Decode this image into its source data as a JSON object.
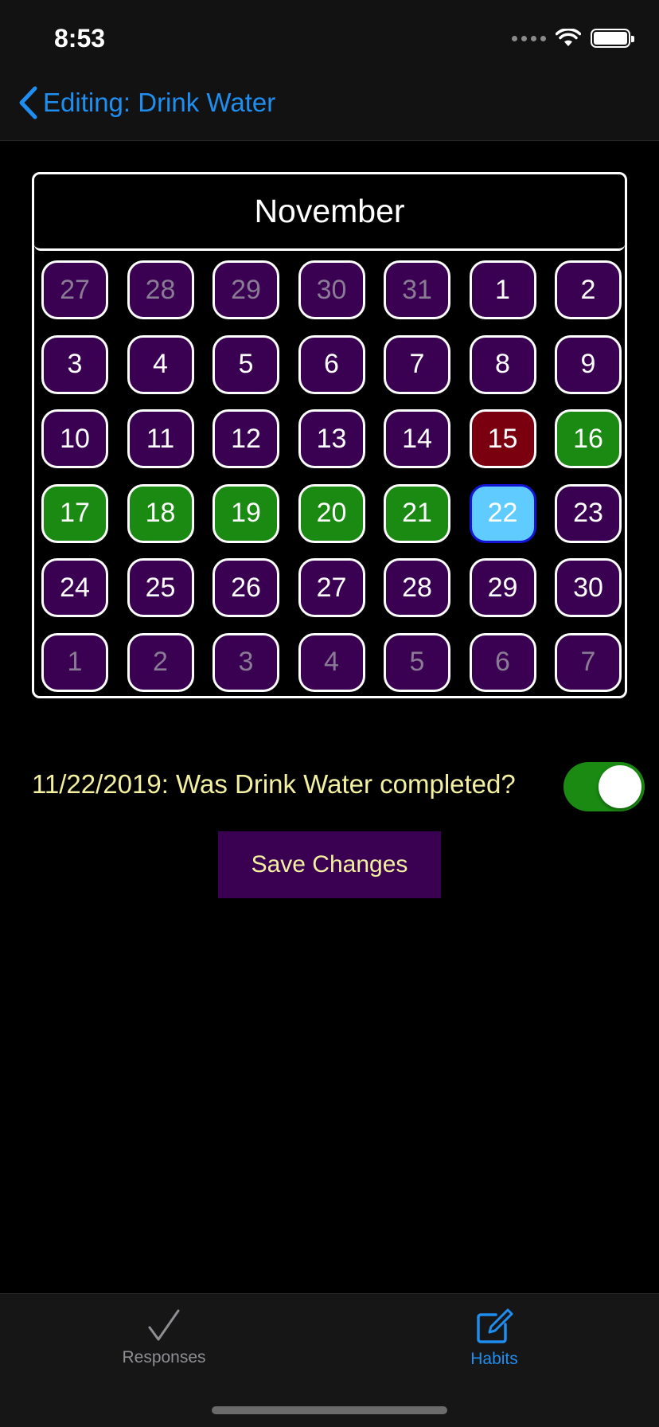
{
  "status_bar": {
    "time": "8:53"
  },
  "nav": {
    "back_icon": "chevron-left-icon",
    "title": "Editing: Drink Water"
  },
  "calendar": {
    "month": "November",
    "colors": {
      "default": "#3a0052",
      "completed": "#1a8a12",
      "missed": "#7a0010",
      "selected": "#5fcbff"
    },
    "days": [
      {
        "label": "27",
        "state": "outside"
      },
      {
        "label": "28",
        "state": "outside"
      },
      {
        "label": "29",
        "state": "outside"
      },
      {
        "label": "30",
        "state": "outside"
      },
      {
        "label": "31",
        "state": "outside"
      },
      {
        "label": "1",
        "state": "default"
      },
      {
        "label": "2",
        "state": "default"
      },
      {
        "label": "3",
        "state": "default"
      },
      {
        "label": "4",
        "state": "default"
      },
      {
        "label": "5",
        "state": "default"
      },
      {
        "label": "6",
        "state": "default"
      },
      {
        "label": "7",
        "state": "default"
      },
      {
        "label": "8",
        "state": "default"
      },
      {
        "label": "9",
        "state": "default"
      },
      {
        "label": "10",
        "state": "default"
      },
      {
        "label": "11",
        "state": "default"
      },
      {
        "label": "12",
        "state": "default"
      },
      {
        "label": "13",
        "state": "default"
      },
      {
        "label": "14",
        "state": "default"
      },
      {
        "label": "15",
        "state": "missed"
      },
      {
        "label": "16",
        "state": "done"
      },
      {
        "label": "17",
        "state": "done"
      },
      {
        "label": "18",
        "state": "done"
      },
      {
        "label": "19",
        "state": "done"
      },
      {
        "label": "20",
        "state": "done"
      },
      {
        "label": "21",
        "state": "done"
      },
      {
        "label": "22",
        "state": "selected"
      },
      {
        "label": "23",
        "state": "default"
      },
      {
        "label": "24",
        "state": "default"
      },
      {
        "label": "25",
        "state": "default"
      },
      {
        "label": "26",
        "state": "default"
      },
      {
        "label": "27",
        "state": "default"
      },
      {
        "label": "28",
        "state": "default"
      },
      {
        "label": "29",
        "state": "default"
      },
      {
        "label": "30",
        "state": "default"
      },
      {
        "label": "1",
        "state": "outside"
      },
      {
        "label": "2",
        "state": "outside"
      },
      {
        "label": "3",
        "state": "outside"
      },
      {
        "label": "4",
        "state": "outside"
      },
      {
        "label": "5",
        "state": "outside"
      },
      {
        "label": "6",
        "state": "outside"
      },
      {
        "label": "7",
        "state": "outside"
      }
    ]
  },
  "question": {
    "text": "11/22/2019: Was Drink Water completed?",
    "toggle_on": true
  },
  "save_button": {
    "label": "Save Changes"
  },
  "tabbar": {
    "tabs": [
      {
        "label": "Responses",
        "icon": "checkmark-icon",
        "active": false
      },
      {
        "label": "Habits",
        "icon": "edit-icon",
        "active": true
      }
    ]
  }
}
